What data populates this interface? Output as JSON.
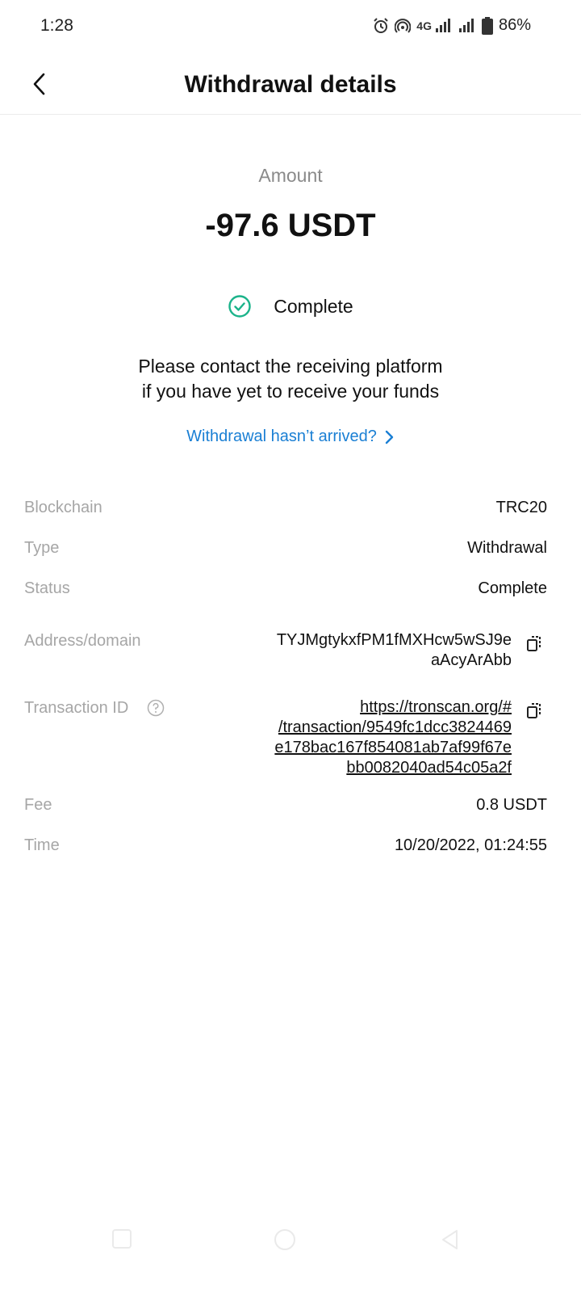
{
  "status_bar": {
    "time": "1:28",
    "network_type": "4G",
    "battery": "86%",
    "icons": [
      "alarm-icon",
      "hotspot-icon",
      "signal-icon",
      "signal-icon",
      "battery-icon"
    ]
  },
  "header": {
    "title": "Withdrawal details",
    "back_icon": "chevron-left-icon"
  },
  "summary": {
    "amount_label": "Amount",
    "amount_value": "-97.6 USDT",
    "status": "Complete",
    "status_color": "#1bb38a",
    "notice_line1": "Please contact the receiving platform",
    "notice_line2": "if you have yet to receive your funds",
    "help_link": "Withdrawal hasn’t arrived?",
    "link_color": "#1a7fd4"
  },
  "details": {
    "blockchain": {
      "label": "Blockchain",
      "value": "TRC20"
    },
    "type": {
      "label": "Type",
      "value": "Withdrawal"
    },
    "status": {
      "label": "Status",
      "value": "Complete"
    },
    "address": {
      "label": "Address/domain",
      "line1": "TYJMgtykxfPM1fMXHcw5wSJ9e",
      "line2": "aAcyArAbb"
    },
    "txid": {
      "label": "Transaction ID",
      "line1": "https://tronscan.org/#",
      "line2": "/transaction/9549fc1dcc3824469",
      "line3": "e178bac167f854081ab7af99f67e",
      "line4": "bb0082040ad54c05a2f"
    },
    "fee": {
      "label": "Fee",
      "value": "0.8 USDT"
    },
    "time": {
      "label": "Time",
      "value": "10/20/2022, 01:24:55"
    }
  }
}
